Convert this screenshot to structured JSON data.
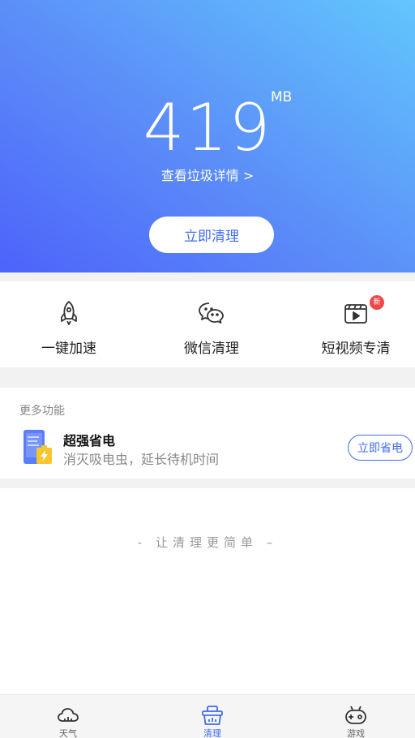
{
  "hero": {
    "junk_size": "419",
    "junk_unit": "MB",
    "detail_link": "查看垃圾详情 >",
    "clean_button": "立即清理"
  },
  "tools": [
    {
      "label": "一键加速",
      "icon": "rocket-icon"
    },
    {
      "label": "微信清理",
      "icon": "wechat-icon"
    },
    {
      "label": "短视频专清",
      "icon": "video-icon",
      "badge": "新"
    }
  ],
  "more": {
    "title": "更多功能",
    "feature_name": "超强省电",
    "feature_desc": "消灭吸电虫，延长待机时间",
    "feature_button": "立即省电",
    "feature_icon": "battery-phone-icon"
  },
  "slogan": "- 让清理更简单 –",
  "tabbar": [
    {
      "label": "天气",
      "icon": "cloud-icon",
      "active": false
    },
    {
      "label": "清理",
      "icon": "basket-icon",
      "active": true
    },
    {
      "label": "游戏",
      "icon": "gamepad-icon",
      "active": false
    }
  ],
  "colors": {
    "accent": "#3f6cf3",
    "hero_start": "#4d63fb",
    "hero_end": "#62c6fd",
    "badge": "#f04848"
  }
}
